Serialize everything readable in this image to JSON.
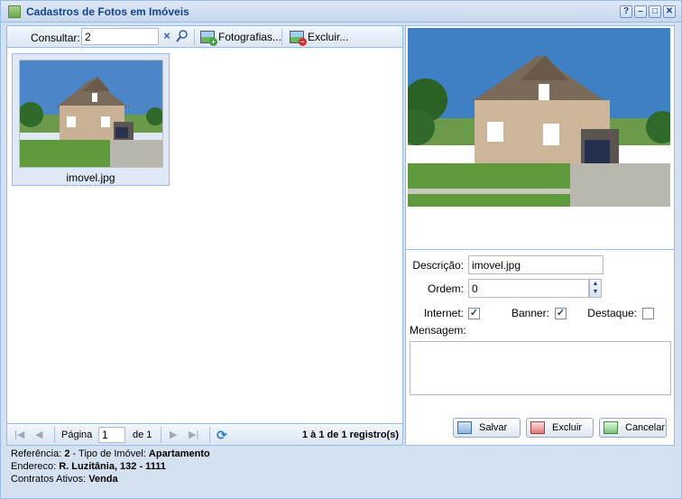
{
  "window": {
    "title": "Cadastros de Fotos em Imóveis",
    "tools": [
      "?",
      "–",
      "□",
      "✕"
    ]
  },
  "toolbar": {
    "search_label": "Consultar:",
    "search_value": "2",
    "photos_label": "Fotografias...",
    "delete_label": "Excluir..."
  },
  "gallery": {
    "items": [
      {
        "name": "imovel.jpg"
      }
    ]
  },
  "pager": {
    "page_label": "Página",
    "page_value": "1",
    "of_label": "de 1",
    "status": "1 à 1 de 1 registro(s)"
  },
  "info": {
    "ref_label": "Referência:",
    "ref_value": "2",
    "type_label": "- Tipo de Imóvel:",
    "type_value": "Apartamento",
    "addr_label": "Endereco:",
    "addr_value": "R. Luzitânia, 132 - 1111",
    "contracts_label": "Contratos Ativos:",
    "contracts_value": "Venda"
  },
  "form": {
    "descricao_label": "Descrição:",
    "descricao_value": "imovel.jpg",
    "ordem_label": "Ordem:",
    "ordem_value": "0",
    "internet_label": "Internet:",
    "internet_checked": true,
    "banner_label": "Banner:",
    "banner_checked": true,
    "destaque_label": "Destaque:",
    "destaque_checked": false,
    "mensagem_label": "Mensagem:",
    "mensagem_value": ""
  },
  "buttons": {
    "save": "Salvar",
    "delete": "Excluir",
    "cancel": "Cancelar"
  },
  "colors": {
    "accent": "#15428b",
    "border": "#99bbe8",
    "panel_bg": "#d3e1f1"
  }
}
